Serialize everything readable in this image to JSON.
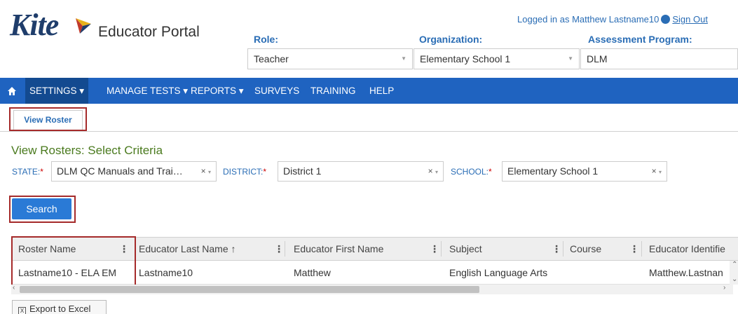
{
  "header": {
    "logo_word": "Kite",
    "logo_subtitle": "Educator Portal",
    "login_prefix": "Logged in as Matthew Lastname10",
    "sign_out": "Sign Out",
    "role_label": "Role:",
    "role_value": "Teacher",
    "org_label": "Organization:",
    "org_value": "Elementary School 1",
    "program_label": "Assessment Program:",
    "program_value": "DLM"
  },
  "nav": {
    "settings": "SETTINGS ▾",
    "manage_tests": "MANAGE TESTS ▾",
    "reports": "REPORTS ▾",
    "surveys": "SURVEYS",
    "training": "TRAINING",
    "help": "HELP"
  },
  "tab": {
    "view_roster": "View Roster"
  },
  "criteria": {
    "title": "View Rosters: Select Criteria",
    "state_label": "STATE:",
    "state_value": "DLM QC Manuals and Trai…",
    "district_label": "DISTRICT:",
    "district_value": "District 1",
    "school_label": "SCHOOL:",
    "school_value": "Elementary School 1",
    "required_mark": "*",
    "clear_mark": "×",
    "caret_mark": "▾"
  },
  "search_label": "Search",
  "table": {
    "columns": [
      "Roster Name",
      "Educator Last Name ↑",
      "Educator First Name",
      "Subject",
      "Course",
      "Educator Identifie"
    ],
    "rows": [
      [
        "Lastname10 - ELA EM",
        "Lastname10",
        "Matthew",
        "English Language Arts",
        "",
        "Matthew.Lastnan"
      ]
    ]
  },
  "export_label": "Export to Excel",
  "colors": {
    "nav_bg": "#1f63c0",
    "accent": "#2a6db5",
    "highlight": "#a52a2a",
    "criteria_title": "#4a7a1e"
  }
}
